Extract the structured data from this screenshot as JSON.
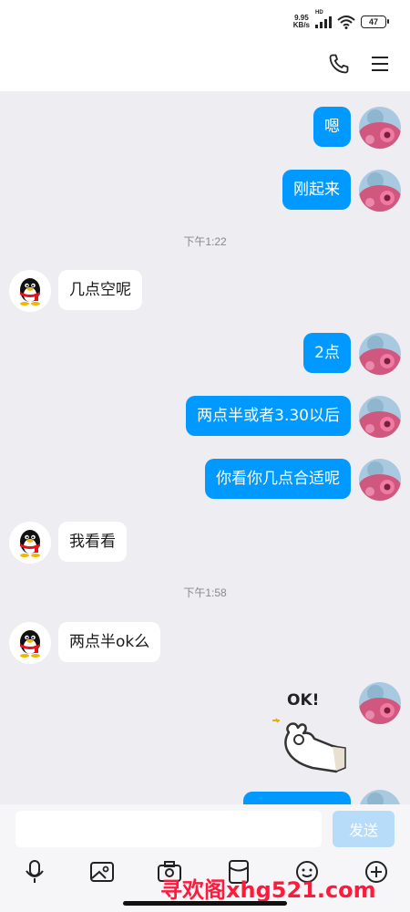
{
  "status_bar": {
    "speed_value": "9.95",
    "speed_unit": "KB/s",
    "hd_label": "HD",
    "battery": "47"
  },
  "header": {
    "icons": [
      "phone-icon",
      "menu-icon"
    ]
  },
  "messages": [
    {
      "side": "me",
      "text": "嗯"
    },
    {
      "side": "me",
      "text": "刚起来"
    },
    {
      "type": "time",
      "text": "下午1:22"
    },
    {
      "side": "them",
      "text": "几点空呢"
    },
    {
      "side": "me",
      "text": "2点"
    },
    {
      "side": "me",
      "text": "两点半或者3.30以后"
    },
    {
      "side": "me",
      "text": "你看你几点合适呢"
    },
    {
      "side": "them",
      "text": "我看看"
    },
    {
      "type": "time",
      "text": "下午1:58"
    },
    {
      "side": "them",
      "text": "两点半ok么"
    },
    {
      "side": "me",
      "type": "sticker",
      "text": "OK!"
    }
  ],
  "composer": {
    "input_value": "",
    "send_label": "发送",
    "tools": [
      "microphone-icon",
      "image-icon",
      "camera-icon",
      "red-packet-icon",
      "emoji-icon",
      "plus-icon"
    ]
  },
  "watermark": "寻欢阁xhg521.com",
  "colors": {
    "my_bubble": "#0099ff",
    "their_bubble": "#ffffff",
    "chat_bg": "#ededf2",
    "send_button": "#b7dcfa"
  }
}
